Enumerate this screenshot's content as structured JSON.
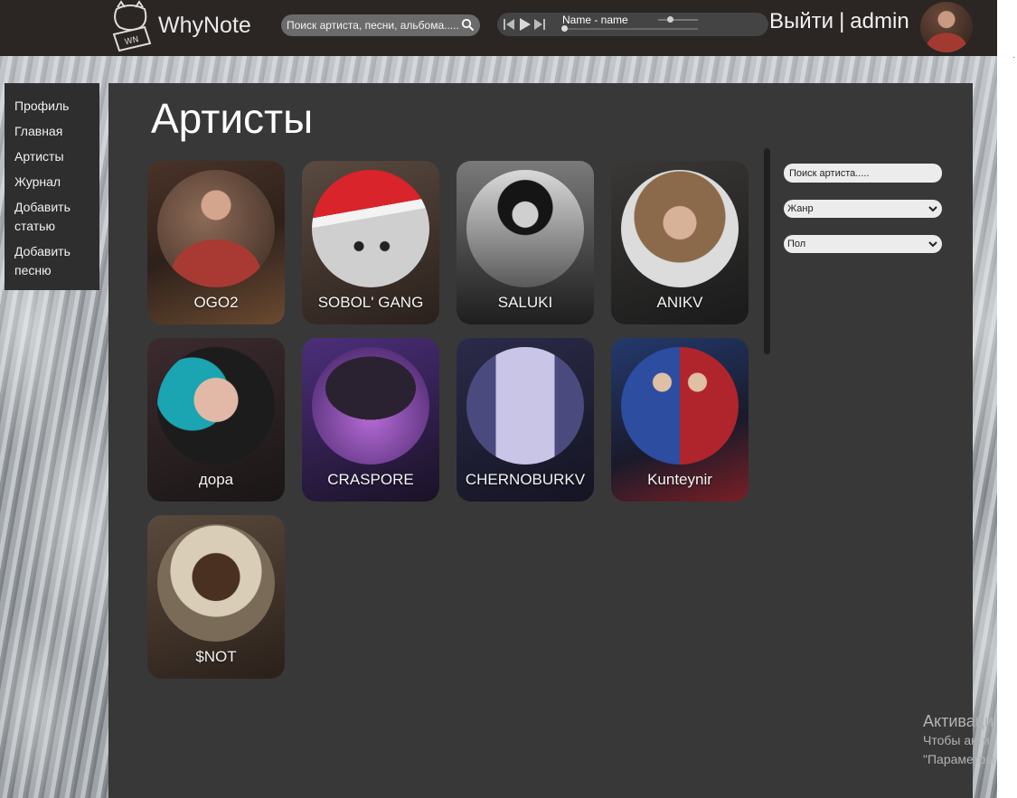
{
  "header": {
    "logo_text": "WhyNote",
    "search_placeholder": "Поиск артиста, песни, альбома.....",
    "player": {
      "track": "Name - name",
      "progress": 0.0,
      "volume": 0.3
    },
    "logout_label": "Выйти",
    "separator": "|",
    "username": "admin"
  },
  "sidebar": {
    "items": [
      {
        "label": "Профиль"
      },
      {
        "label": "Главная"
      },
      {
        "label": "Артисты"
      },
      {
        "label": "Журнал"
      },
      {
        "label": "Добавить статью"
      },
      {
        "label": "Добавить песню"
      }
    ]
  },
  "main": {
    "title": "Артисты",
    "artists": [
      {
        "name": "OGO2"
      },
      {
        "name": "SOBOL' GANG"
      },
      {
        "name": "SALUKI"
      },
      {
        "name": "ANIKV"
      },
      {
        "name": "дора"
      },
      {
        "name": "CRASPORE"
      },
      {
        "name": "CHERNOBURKV"
      },
      {
        "name": "Kunteynir"
      },
      {
        "name": "$NOT"
      }
    ],
    "filters": {
      "search_placeholder": "Поиск артиста.....",
      "genre_label": "Жанр",
      "gender_label": "Пол"
    }
  },
  "watermark": {
    "line1": "Активаци",
    "line2": "Чтобы акти",
    "line3": "\"Параметры"
  },
  "colors": {
    "header_bg": "#2b2523",
    "panel_bg": "#383838",
    "sidebar_bg": "#2e2e2e"
  }
}
